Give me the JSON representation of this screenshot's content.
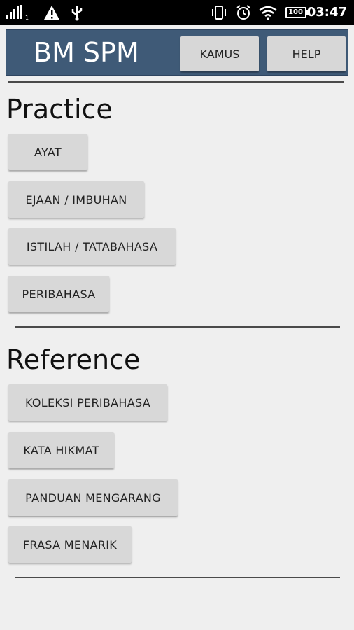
{
  "status_bar": {
    "time": "03:47",
    "battery": "100",
    "icons": [
      "signal-icon",
      "warning-icon",
      "usb-icon",
      "vibrate-icon",
      "alarm-icon",
      "wifi-icon",
      "battery-icon"
    ]
  },
  "app_bar": {
    "title": "BM SPM",
    "background_color": "#3f5a77",
    "kamus_label": "KAMUS",
    "help_label": "HELP"
  },
  "practice": {
    "heading": "Practice",
    "buttons": [
      "AYAT",
      "EJAAN / IMBUHAN",
      "ISTILAH / TATABAHASA",
      "PERIBAHASA"
    ]
  },
  "reference": {
    "heading": "Reference",
    "buttons": [
      "KOLEKSI PERIBAHASA",
      "KATA HIKMAT",
      "PANDUAN MENGARANG",
      "FRASA MENARIK"
    ]
  }
}
